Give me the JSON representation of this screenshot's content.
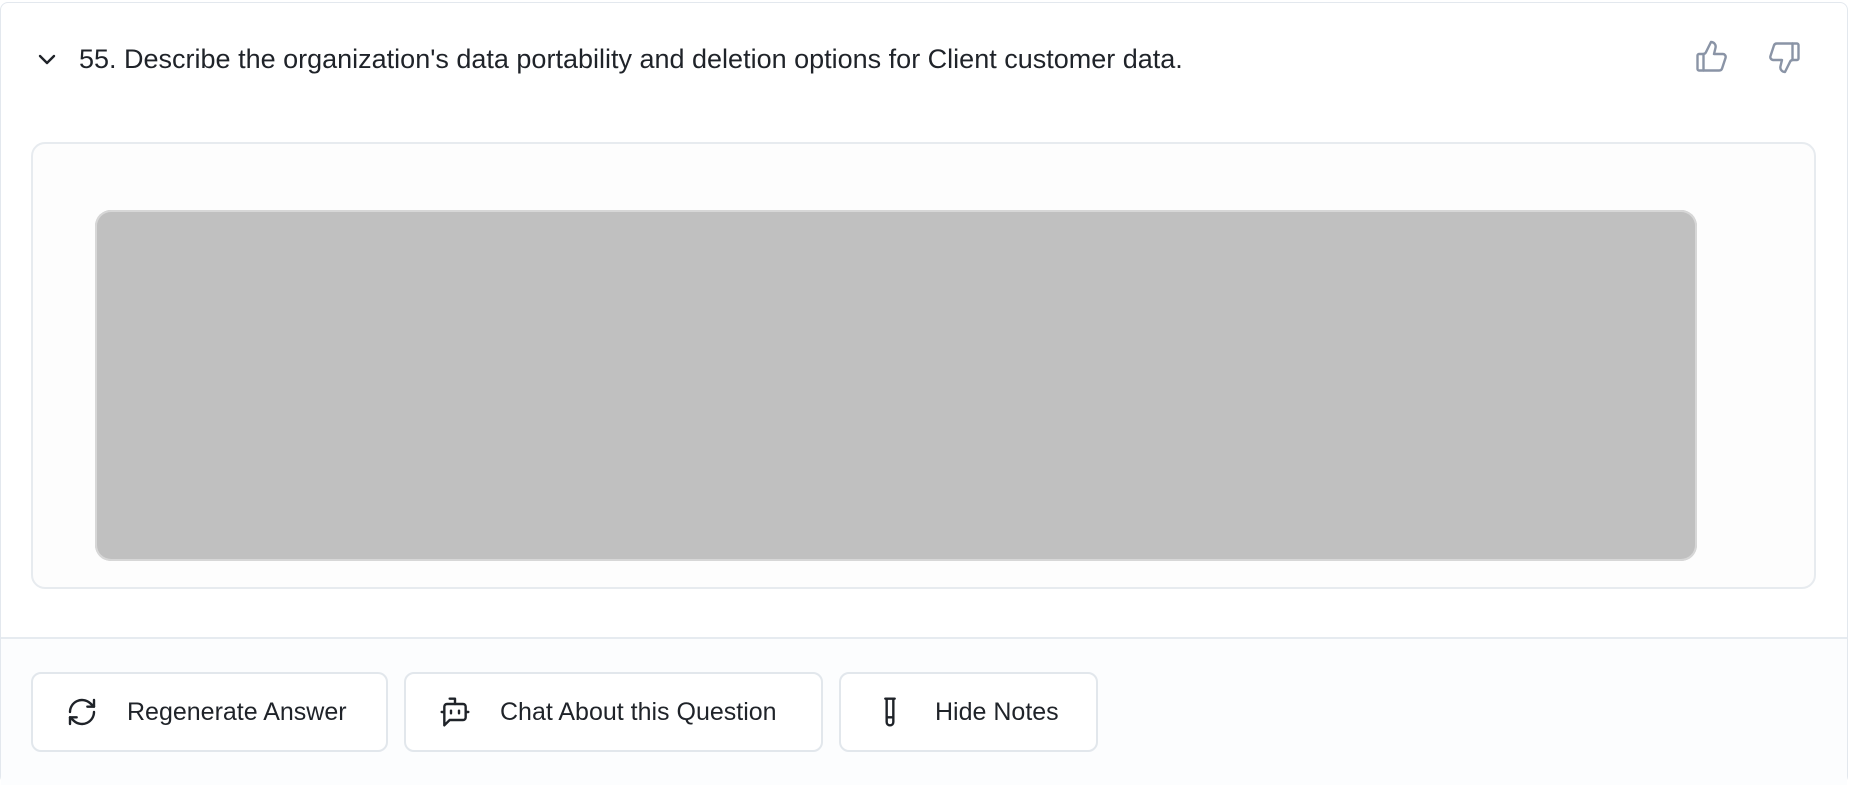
{
  "question": {
    "text": "55. Describe the organization's data portability and deletion options for Client customer data."
  },
  "icons": {
    "collapse": "chevron-down-icon",
    "like": "thumbs-up-icon",
    "dislike": "thumbs-down-icon",
    "regenerate": "refresh-icon",
    "chat": "bot-icon",
    "notes": "test-tube-icon"
  },
  "actions": {
    "regenerate_label": "Regenerate Answer",
    "chat_label": "Chat About this Question",
    "notes_label": "Hide Notes"
  },
  "colors": {
    "text": "#1f2329",
    "icon_muted": "#8a94a6",
    "placeholder": "#c0c0c0",
    "border": "#e3e8ee"
  }
}
